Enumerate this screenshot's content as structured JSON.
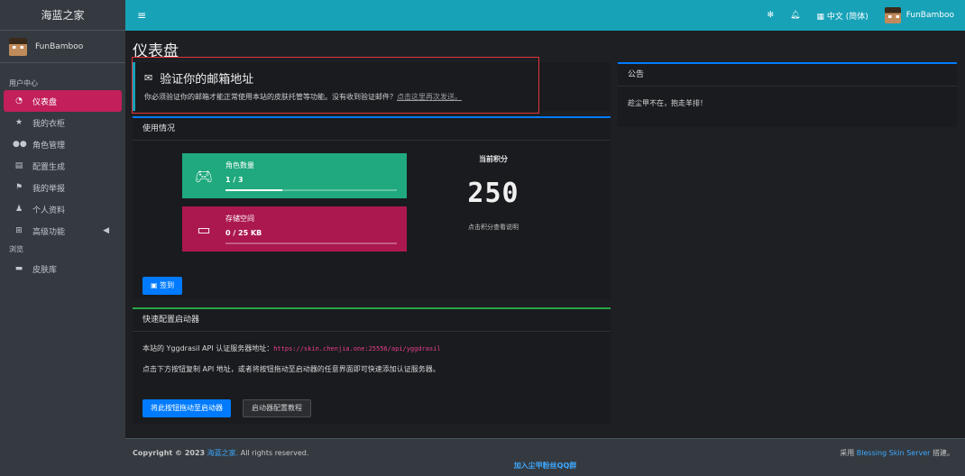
{
  "sidebar": {
    "brand": "海蓝之家",
    "user_name": "FunBamboo",
    "section_user": "用户中心",
    "items": [
      {
        "label": "仪表盘",
        "icon": "dashboard-icon"
      },
      {
        "label": "我的衣柜",
        "icon": "star-icon"
      },
      {
        "label": "角色管理",
        "icon": "users-icon"
      },
      {
        "label": "配置生成",
        "icon": "file-icon"
      },
      {
        "label": "我的举报",
        "icon": "flag-icon"
      },
      {
        "label": "个人资料",
        "icon": "user-icon"
      },
      {
        "label": "高级功能",
        "icon": "plugin-icon"
      }
    ],
    "section_browse": "浏览",
    "browse_items": [
      {
        "label": "皮肤库",
        "icon": "archive-icon"
      }
    ]
  },
  "topbar": {
    "language": "中文 (简体)",
    "user_name": "FunBamboo"
  },
  "page_title": "仪表盘",
  "verify_email": {
    "title": "验证你的邮箱地址",
    "text": "你必须验证你的邮箱才能正常使用本站的皮肤托管等功能。没有收到验证邮件？",
    "link": "点击这里再次发送。"
  },
  "usage": {
    "title": "使用情况",
    "roles": {
      "label": "角色数量",
      "value": "1 / 3",
      "progress": 0.333,
      "color": "#20a97e"
    },
    "storage": {
      "label": "存储空间",
      "value": "0 / 25 KB",
      "progress": 0,
      "color": "#ab1850"
    },
    "score_label": "当前积分",
    "score": "250",
    "score_hint": "点击积分查看说明",
    "sign_label": "签到"
  },
  "quick": {
    "title": "快速配置启动器",
    "api_text": "本站的 Yggdrasil API 认证服务器地址：",
    "api_url": "https://skin.chenjia.one:25556/api/yggdrasil",
    "hint": "点击下方按钮复制 API 地址，或者将按钮拖动至启动器的任意界面即可快速添加认证服务器。",
    "drag_button": "将此按钮拖动至启动器",
    "tutorial_button": "启动器配置教程"
  },
  "announcement": {
    "title": "公告",
    "text": "趁尘甲不在，抱走羊排！"
  },
  "footer": {
    "copyright_prefix": "Copyright © 2023",
    "site": "海蓝之家.",
    "rights": "All rights reserved.",
    "powered_prefix": "采用",
    "powered_name": "Blessing Skin Server",
    "powered_suffix": "搭建。",
    "group_link": "加入尘甲粉丝QQ群"
  },
  "colors": {
    "topbar": "#17a2b8",
    "sidebar": "#343a40",
    "active": "#c21f5b",
    "primary": "#007bff"
  }
}
